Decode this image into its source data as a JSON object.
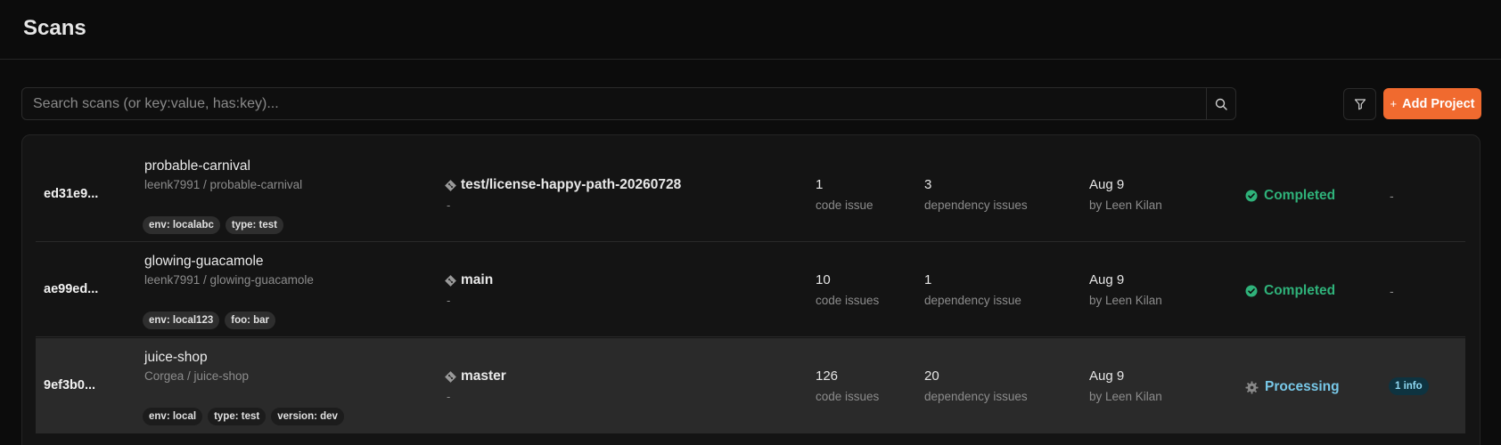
{
  "header": {
    "title": "Scans"
  },
  "search": {
    "placeholder": "Search scans (or key:value, has:key)...",
    "value": ""
  },
  "toolbar": {
    "add_label": "Add Project",
    "add_plus": "+"
  },
  "colors": {
    "accent": "#f06a2f",
    "completed": "#2fb27a",
    "processing": "#78c8e8"
  },
  "icons": {
    "search": "search-icon",
    "filter": "filter-icon",
    "branch": "git-branch-icon",
    "completed": "check-circle-icon",
    "processing": "gear-icon"
  },
  "rows": [
    {
      "id": "ed31e9...",
      "project": "probable-carnival",
      "path": "leenk7991 / probable-carnival",
      "tags": [
        "env: localabc",
        "type: test"
      ],
      "branch": "test/license-happy-path-20260728",
      "branch_sub": "-",
      "code_count": "1",
      "code_label": "code issue",
      "dep_count": "3",
      "dep_label": "dependency issues",
      "date": "Aug 9",
      "by": "by Leen Kilan",
      "status": "Completed",
      "extra": "-"
    },
    {
      "id": "ae99ed...",
      "project": "glowing-guacamole",
      "path": "leenk7991 / glowing-guacamole",
      "tags": [
        "env: local123",
        "foo: bar"
      ],
      "branch": "main",
      "branch_sub": "-",
      "code_count": "10",
      "code_label": "code issues",
      "dep_count": "1",
      "dep_label": "dependency issue",
      "date": "Aug 9",
      "by": "by Leen Kilan",
      "status": "Completed",
      "extra": "-"
    },
    {
      "id": "9ef3b0...",
      "project": "juice-shop",
      "path": "Corgea / juice-shop",
      "tags": [
        "env: local",
        "type: test",
        "version: dev"
      ],
      "branch": "master",
      "branch_sub": "-",
      "code_count": "126",
      "code_label": "code issues",
      "dep_count": "20",
      "dep_label": "dependency issues",
      "date": "Aug 9",
      "by": "by Leen Kilan",
      "status": "Processing",
      "extra": "1 info"
    }
  ]
}
